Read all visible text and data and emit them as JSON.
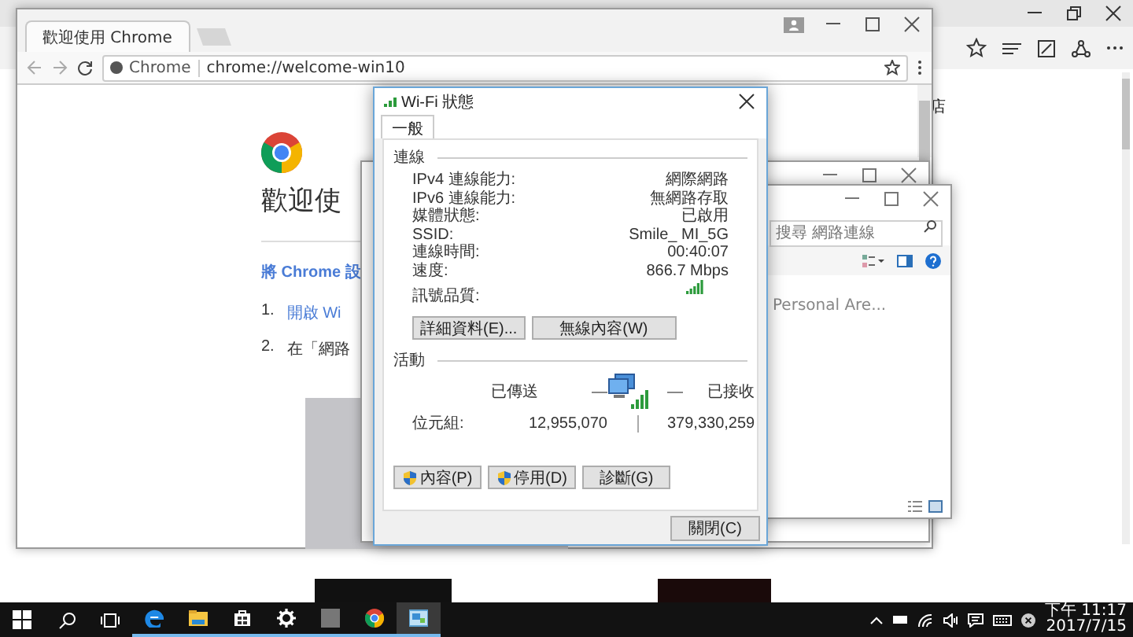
{
  "edge_window": {
    "partial_text": "店"
  },
  "chrome_window": {
    "tab": {
      "title": "歡迎使用 Chrome",
      "selected": true
    },
    "address_bar": {
      "site_label": "Chrome",
      "url": "chrome://welcome-win10"
    },
    "page": {
      "heading": "歡迎使",
      "intro_link": "將 Chrome 設",
      "steps": [
        {
          "number": "1.",
          "text": "開啟 Wi",
          "kind": "link"
        },
        {
          "number": "2.",
          "text": "在「網路",
          "kind": "text"
        }
      ]
    }
  },
  "explorer_window": {
    "search": {
      "placeholder": "搜尋 網路連線"
    },
    "item_text": "Personal Are..."
  },
  "wifi_dialog": {
    "title": "Wi-Fi 狀態",
    "tabs": [
      {
        "label": "一般",
        "selected": true
      }
    ],
    "connection": {
      "heading": "連線",
      "rows": [
        {
          "kind": "text",
          "label": "IPv4 連線能力:",
          "value": "網際網路"
        },
        {
          "kind": "text",
          "label": "IPv6 連線能力:",
          "value": "無網路存取"
        },
        {
          "kind": "text",
          "label": "媒體狀態:",
          "value": "已啟用"
        },
        {
          "kind": "text",
          "label": "SSID:",
          "value": "Smile_ MI_5G"
        },
        {
          "kind": "text",
          "label": "連線時間:",
          "value": "00:40:07"
        },
        {
          "kind": "text",
          "label": "速度:",
          "value": "866.7 Mbps"
        },
        {
          "kind": "signal",
          "label": "訊號品質:"
        }
      ],
      "buttons": [
        "詳細資料(E)...",
        "無線內容(W)"
      ]
    },
    "activity": {
      "heading": "活動",
      "sent_label": "已傳送",
      "received_label": "已接收",
      "bytes_label": "位元組:",
      "sent_bytes": "12,955,070",
      "received_bytes": "379,330,259"
    },
    "buttons": [
      {
        "label": "內容(P)",
        "kind": "shield"
      },
      {
        "label": "停用(D)",
        "kind": "shield"
      },
      {
        "label": "診斷(G)",
        "kind": "plain"
      }
    ],
    "close_button": "關閉(C)"
  },
  "taskbar": {
    "apps": [
      {
        "kind": "edge",
        "selected": false
      },
      {
        "kind": "folder",
        "selected": false
      },
      {
        "kind": "store",
        "selected": false
      },
      {
        "kind": "gear",
        "selected": false
      },
      {
        "kind": "photo",
        "selected": false
      },
      {
        "kind": "chrome",
        "selected": false
      },
      {
        "kind": "network",
        "selected": true
      }
    ],
    "clock": {
      "time": "下午 11:17",
      "date": "2017/7/15"
    }
  }
}
